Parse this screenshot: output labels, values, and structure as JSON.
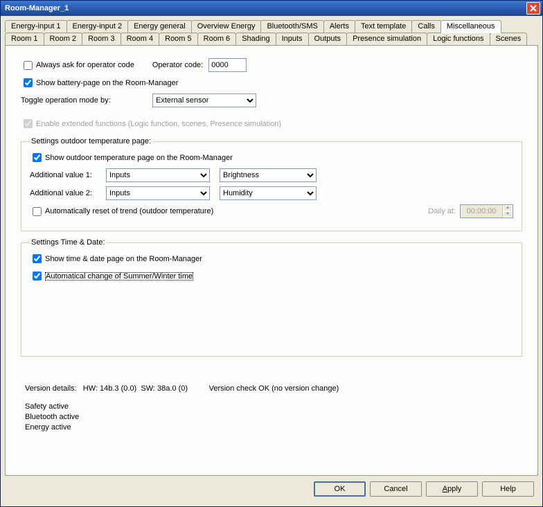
{
  "window": {
    "title": "Room-Manager_1"
  },
  "tabs_row1": [
    "Room 1",
    "Room 2",
    "Room 3",
    "Room 4",
    "Room 5",
    "Room 6",
    "Shading",
    "Inputs",
    "Outputs",
    "Presence simulation",
    "Logic functions",
    "Scenes"
  ],
  "tabs_row2": [
    "Energy-input 1",
    "Energy-input 2",
    "Energy general",
    "Overview Energy",
    "Bluetooth/SMS",
    "Alerts",
    "Text template",
    "Calls",
    "Miscellaneous"
  ],
  "active_tab": "Miscellaneous",
  "misc": {
    "ask_operator_label": "Always ask for operator code",
    "ask_operator_checked": false,
    "operator_code_label": "Operator code:",
    "operator_code_value": "0000",
    "show_battery_label": "Show battery-page on the Room-Manager",
    "show_battery_checked": true,
    "toggle_mode_label": "Toggle operation mode by:",
    "toggle_mode_value": "External sensor",
    "toggle_mode_options": [
      "External sensor"
    ],
    "enable_ext_label": "Enable extended functions (Logic function, scenes, Presence simulation)",
    "enable_ext_checked": true
  },
  "outdoor": {
    "legend": "Settings outdoor temperature page:",
    "show_outdoor_label": "Show outdoor temperature page on the Room-Manager",
    "show_outdoor_checked": true,
    "add1_label": "Additional value 1:",
    "add1_src": "Inputs",
    "add1_type": "Brightness",
    "add2_label": "Additional value 2:",
    "add2_src": "Inputs",
    "add2_type": "Humidity",
    "src_options": [
      "Inputs"
    ],
    "type_options1": [
      "Brightness"
    ],
    "type_options2": [
      "Humidity"
    ],
    "auto_reset_label": "Automatically reset of trend (outdoor temperature)",
    "auto_reset_checked": false,
    "daily_label": "Daily at:",
    "daily_value": "00:00:00"
  },
  "timedate": {
    "legend": "Settings Time & Date:",
    "show_td_label": "Show time & date page on the Room-Manager",
    "show_td_checked": true,
    "auto_dst_label": "Automatical change of Summer/Winter time",
    "auto_dst_checked": true
  },
  "version": {
    "prefix": "Version details:",
    "hw": "HW: 14b.3 (0.0)",
    "sw": "SW: 38a.0 (0)",
    "check": "Version check OK (no version change)"
  },
  "status": [
    "Safety active",
    "Bluetooth active",
    "Energy active"
  ],
  "buttons": {
    "ok": "OK",
    "cancel": "Cancel",
    "apply": "Apply",
    "help": "Help"
  }
}
